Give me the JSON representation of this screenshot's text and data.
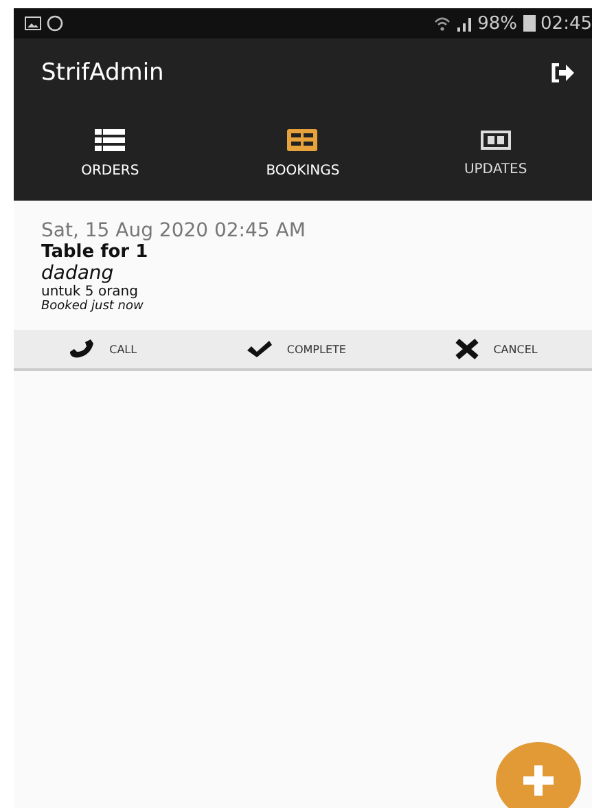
{
  "status_bar": {
    "battery": "98%",
    "time": "02:45"
  },
  "app_bar": {
    "title": "StrifAdmin"
  },
  "tabs": [
    {
      "label": "ORDERS",
      "selected": false
    },
    {
      "label": "BOOKINGS",
      "selected": true
    },
    {
      "label": "UPDATES",
      "selected": false
    }
  ],
  "booking": {
    "datetime": "Sat, 15 Aug 2020 02:45 AM",
    "table": "Table for 1",
    "name": "dadang",
    "party": "untuk 5 orang",
    "booked": "Booked just now",
    "actions": [
      {
        "label": "CALL"
      },
      {
        "label": "COMPLETE"
      },
      {
        "label": "CANCEL"
      }
    ]
  }
}
